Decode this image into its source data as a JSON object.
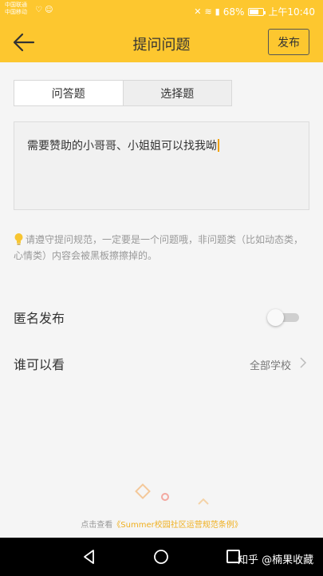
{
  "status_bar": {
    "carrier_line1": "中国联通",
    "carrier_line2": "中国移动",
    "battery": "68%",
    "time": "上午10:40"
  },
  "header": {
    "title": "提问问题",
    "publish_label": "发布"
  },
  "tabs": [
    {
      "label": "问答题",
      "active": true
    },
    {
      "label": "选择题",
      "active": false
    }
  ],
  "question": {
    "text": "需要赞助的小哥哥、小姐姐可以找我呦"
  },
  "tip": {
    "text": "请遵守提问规范，一定要是一个问题哦，非问题类（比如动态类，心情类）内容会被黑板擦擦掉的。"
  },
  "settings": {
    "anonymous_label": "匿名发布",
    "anonymous_on": false,
    "visibility_label": "谁可以看",
    "visibility_value": "全部学校"
  },
  "footer": {
    "prefix": "点击查看",
    "link_text": "《Summer校园社区运营规范条例》"
  },
  "watermark": "知乎 @楠果收藏",
  "colors": {
    "brand": "#fdc72f",
    "link": "#f0b020"
  }
}
